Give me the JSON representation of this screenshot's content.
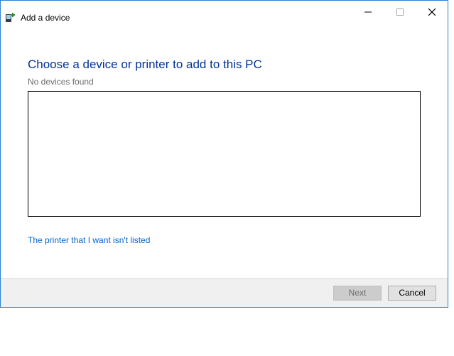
{
  "window": {
    "title": "Add a device"
  },
  "content": {
    "heading": "Choose a device or printer to add to this PC",
    "status_text": "No devices found",
    "link_text": "The printer that I want isn't listed"
  },
  "footer": {
    "next_label": "Next",
    "cancel_label": "Cancel"
  },
  "icons": {
    "minimize": "minimize-icon",
    "maximize": "maximize-icon",
    "close": "close-icon",
    "device": "device-add-icon"
  }
}
